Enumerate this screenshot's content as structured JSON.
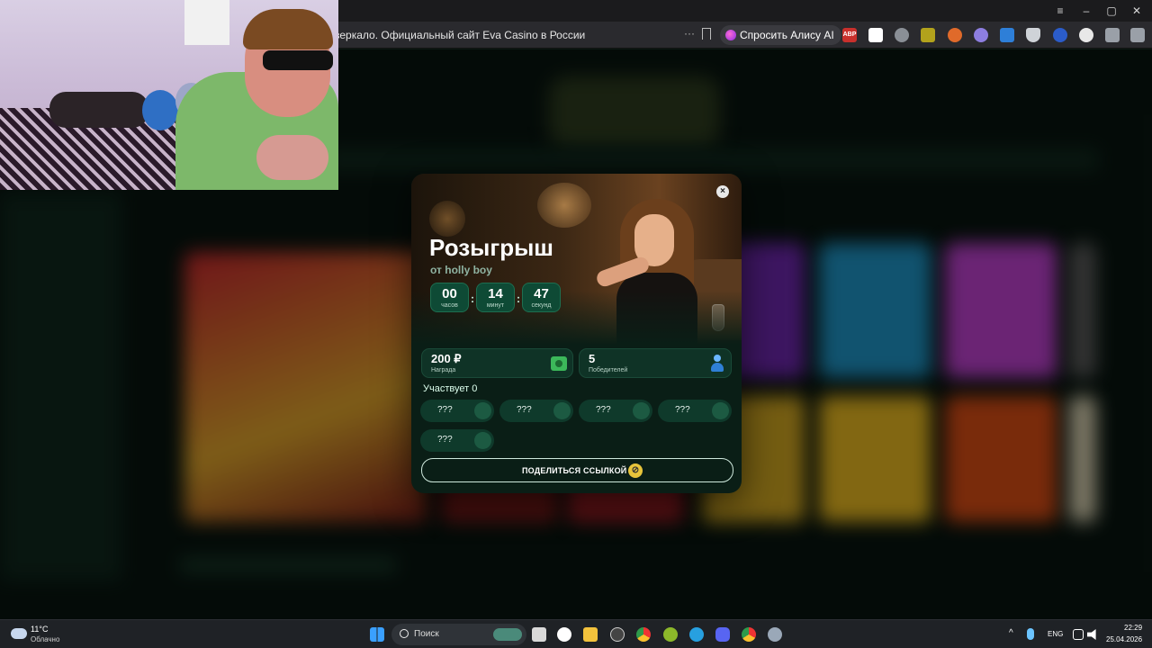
{
  "browser": {
    "url_text": "зеркало. Официальный сайт Eva Casino в России",
    "alice_label": "Спросить Алису AI",
    "ext_abp": "ABP"
  },
  "modal": {
    "title": "Розыгрыш",
    "subtitle": "от holly boy",
    "close": "×",
    "timer": [
      {
        "value": "00",
        "label": "часов"
      },
      {
        "value": "14",
        "label": "минут"
      },
      {
        "value": "47",
        "label": "секунд"
      }
    ],
    "prize": {
      "value": "200 ₽",
      "label": "Награда"
    },
    "winners": {
      "value": "5",
      "label": "Победителей"
    },
    "participants": "Участвует 0",
    "slots": [
      "???",
      "???",
      "???",
      "???",
      "???"
    ],
    "share_label": "ПОДЕЛИТЬСЯ ССЫЛКОЙ"
  },
  "taskbar": {
    "weather_temp": "11°C",
    "weather_desc": "Облачно",
    "search_placeholder": "Поиск",
    "lang": "ENG",
    "time": "22:29",
    "date": "25.04.2026"
  },
  "colors": {
    "accent": "#0e4a35",
    "share_icon": "#e7c43b"
  }
}
